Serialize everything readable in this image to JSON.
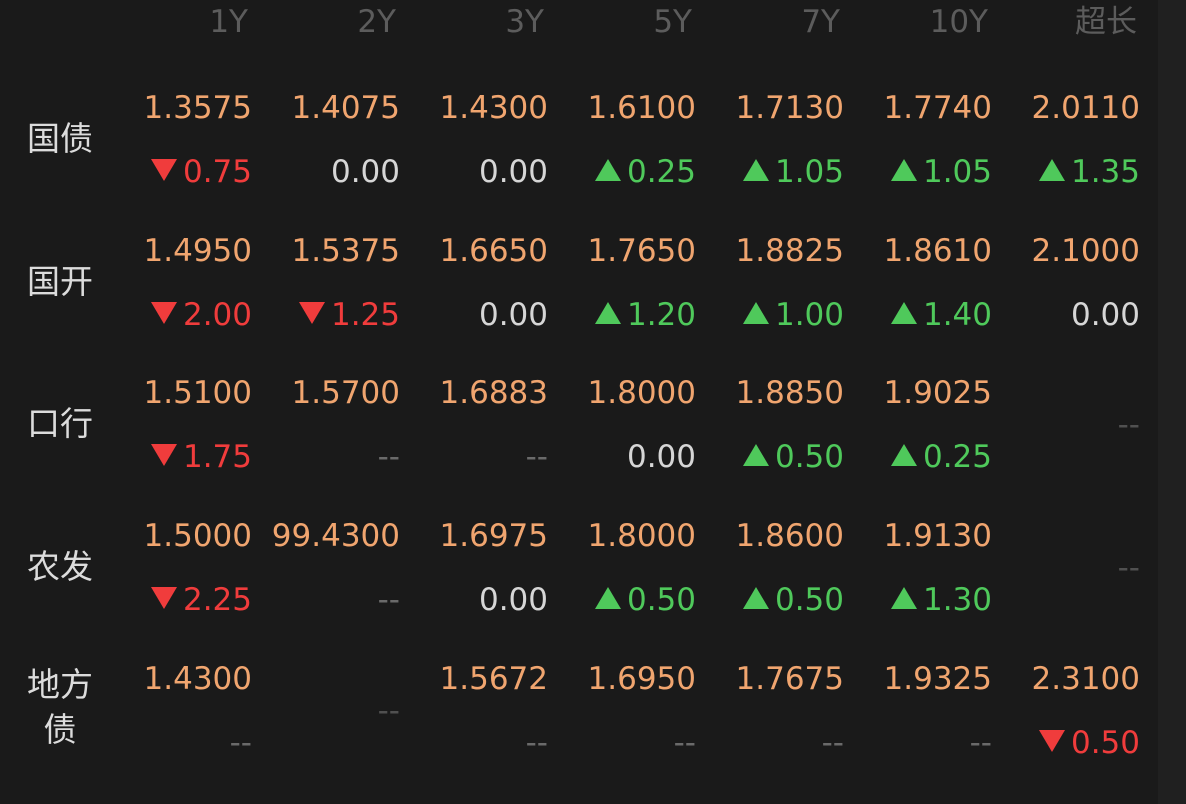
{
  "header": [
    "1Y",
    "2Y",
    "3Y",
    "5Y",
    "7Y",
    "10Y",
    "超长"
  ],
  "rows": [
    {
      "label": "国债",
      "cells": [
        {
          "rate": "1.3575",
          "change": "0.75",
          "dir": "down"
        },
        {
          "rate": "1.4075",
          "change": "0.00",
          "dir": "flat"
        },
        {
          "rate": "1.4300",
          "change": "0.00",
          "dir": "flat"
        },
        {
          "rate": "1.6100",
          "change": "0.25",
          "dir": "up"
        },
        {
          "rate": "1.7130",
          "change": "1.05",
          "dir": "up"
        },
        {
          "rate": "1.7740",
          "change": "1.05",
          "dir": "up"
        },
        {
          "rate": "2.0110",
          "change": "1.35",
          "dir": "up"
        }
      ]
    },
    {
      "label": "国开",
      "cells": [
        {
          "rate": "1.4950",
          "change": "2.00",
          "dir": "down"
        },
        {
          "rate": "1.5375",
          "change": "1.25",
          "dir": "down"
        },
        {
          "rate": "1.6650",
          "change": "0.00",
          "dir": "flat"
        },
        {
          "rate": "1.7650",
          "change": "1.20",
          "dir": "up"
        },
        {
          "rate": "1.8825",
          "change": "1.00",
          "dir": "up"
        },
        {
          "rate": "1.8610",
          "change": "1.40",
          "dir": "up"
        },
        {
          "rate": "2.1000",
          "change": "0.00",
          "dir": "flat"
        }
      ]
    },
    {
      "label": "口行",
      "cells": [
        {
          "rate": "1.5100",
          "change": "1.75",
          "dir": "down"
        },
        {
          "rate": "1.5700",
          "change": "--",
          "dir": "na"
        },
        {
          "rate": "1.6883",
          "change": "--",
          "dir": "na"
        },
        {
          "rate": "1.8000",
          "change": "0.00",
          "dir": "flat"
        },
        {
          "rate": "1.8850",
          "change": "0.50",
          "dir": "up"
        },
        {
          "rate": "1.9025",
          "change": "0.25",
          "dir": "up"
        },
        {
          "empty": "--"
        }
      ]
    },
    {
      "label": "农发",
      "cells": [
        {
          "rate": "1.5000",
          "change": "2.25",
          "dir": "down"
        },
        {
          "rate": "99.4300",
          "change": "--",
          "dir": "na"
        },
        {
          "rate": "1.6975",
          "change": "0.00",
          "dir": "flat"
        },
        {
          "rate": "1.8000",
          "change": "0.50",
          "dir": "up"
        },
        {
          "rate": "1.8600",
          "change": "0.50",
          "dir": "up"
        },
        {
          "rate": "1.9130",
          "change": "1.30",
          "dir": "up"
        },
        {
          "empty": "--"
        }
      ]
    },
    {
      "label": "地方债",
      "label_lines": [
        "地方",
        "债"
      ],
      "cells": [
        {
          "rate": "1.4300",
          "change": "--",
          "dir": "na"
        },
        {
          "empty": "--"
        },
        {
          "rate": "1.5672",
          "change": "--",
          "dir": "na"
        },
        {
          "rate": "1.6950",
          "change": "--",
          "dir": "na"
        },
        {
          "rate": "1.7675",
          "change": "--",
          "dir": "na"
        },
        {
          "rate": "1.9325",
          "change": "--",
          "dir": "na"
        },
        {
          "rate": "2.3100",
          "change": "0.50",
          "dir": "down"
        }
      ]
    }
  ],
  "colors": {
    "background": "#1a1a1a",
    "header_text": "#5c5c5c",
    "label_text": "#dcdcdc",
    "rate_text": "#f0a56f",
    "up": "#4fc95b",
    "down": "#f03c3c",
    "flat": "#d6d6d6",
    "na": "#6a6a6a"
  },
  "icons": {
    "up": "triangle-up-icon",
    "down": "triangle-down-icon"
  }
}
